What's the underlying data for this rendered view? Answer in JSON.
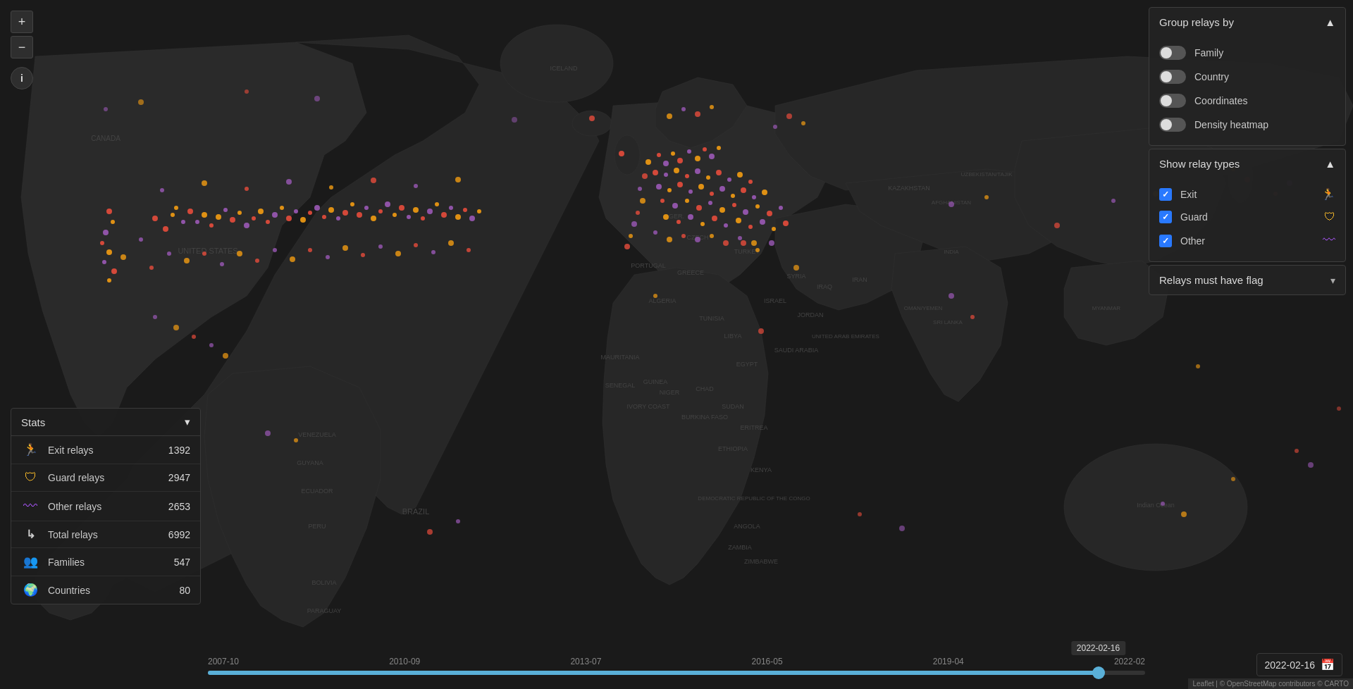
{
  "map": {
    "zoom_in_label": "+",
    "zoom_out_label": "−",
    "info_label": "i",
    "attribution": "Leaflet | © OpenStreetMap contributors © CARTO"
  },
  "stats_panel": {
    "title": "Stats",
    "chevron": "▾",
    "rows": [
      {
        "id": "exit",
        "icon": "🏃",
        "icon_color": "#e05555",
        "label": "Exit relays",
        "value": "1392"
      },
      {
        "id": "guard",
        "icon": "🛡",
        "icon_color": "#f0b429",
        "label": "Guard relays",
        "value": "2947"
      },
      {
        "id": "other",
        "icon": "〰",
        "icon_color": "#a855f7",
        "label": "Other relays",
        "value": "2653"
      },
      {
        "id": "total",
        "icon": "↳",
        "icon_color": "#ccc",
        "label": "Total relays",
        "value": "6992"
      },
      {
        "id": "families",
        "icon": "👥",
        "icon_color": "#ccc",
        "label": "Families",
        "value": "547"
      },
      {
        "id": "countries",
        "icon": "🌍",
        "icon_color": "#ccc",
        "label": "Countries",
        "value": "80"
      }
    ]
  },
  "timeline": {
    "labels": [
      "2007-10",
      "2010-09",
      "2013-07",
      "2016-05",
      "2019-04",
      "2022-02"
    ],
    "current_date": "2022-02-16",
    "fill_percent": 95
  },
  "date_input": {
    "value": "2022-02-16"
  },
  "group_relays_panel": {
    "title": "Group relays by",
    "toggles": [
      {
        "id": "family",
        "label": "Family",
        "on": false
      },
      {
        "id": "country",
        "label": "Country",
        "on": false
      },
      {
        "id": "coordinates",
        "label": "Coordinates",
        "on": false
      },
      {
        "id": "density",
        "label": "Density heatmap",
        "on": false
      }
    ]
  },
  "relay_types_panel": {
    "title": "Show relay types",
    "types": [
      {
        "id": "exit",
        "label": "Exit",
        "icon": "🏃",
        "checked": true
      },
      {
        "id": "guard",
        "label": "Guard",
        "icon": "🛡",
        "checked": true
      },
      {
        "id": "other",
        "label": "Other",
        "icon": "〰",
        "checked": true
      }
    ]
  },
  "must_flag_panel": {
    "label": "Relays must have flag",
    "chevron": "▾"
  }
}
